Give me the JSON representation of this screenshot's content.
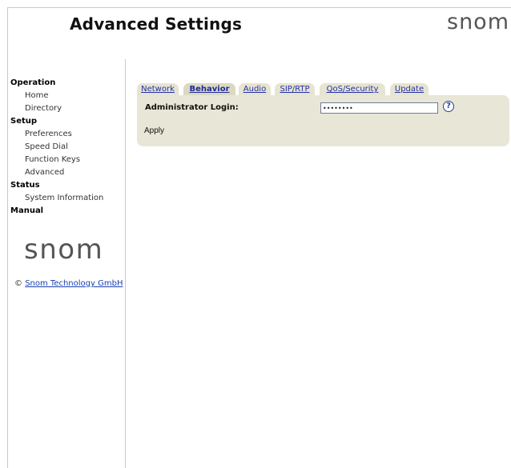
{
  "header": {
    "title": "Advanced Settings",
    "logo": "snom"
  },
  "sidebar": {
    "sections": [
      {
        "label": "Operation",
        "items": [
          "Home",
          "Directory"
        ]
      },
      {
        "label": "Setup",
        "items": [
          "Preferences",
          "Speed Dial",
          "Function Keys",
          "Advanced"
        ]
      },
      {
        "label": "Status",
        "items": [
          "System Information"
        ]
      },
      {
        "label": "Manual",
        "items": []
      }
    ],
    "logo": "snom",
    "copyright_symbol": "©",
    "copyright_link": "Snom Technology GmbH"
  },
  "tabs": {
    "active": "Behavior",
    "items": [
      "Network",
      "Behavior",
      "Audio",
      "SIP/RTP",
      "QoS/Security",
      "Update"
    ]
  },
  "form": {
    "admin_login_label": "Administrator Login:",
    "admin_login_value": "••••••••",
    "help_icon": "question-mark",
    "apply_label": "Apply"
  },
  "colors": {
    "panel_bg": "#e8e6d6",
    "tab_bg": "#e6e4d2",
    "link": "#2430a5"
  }
}
